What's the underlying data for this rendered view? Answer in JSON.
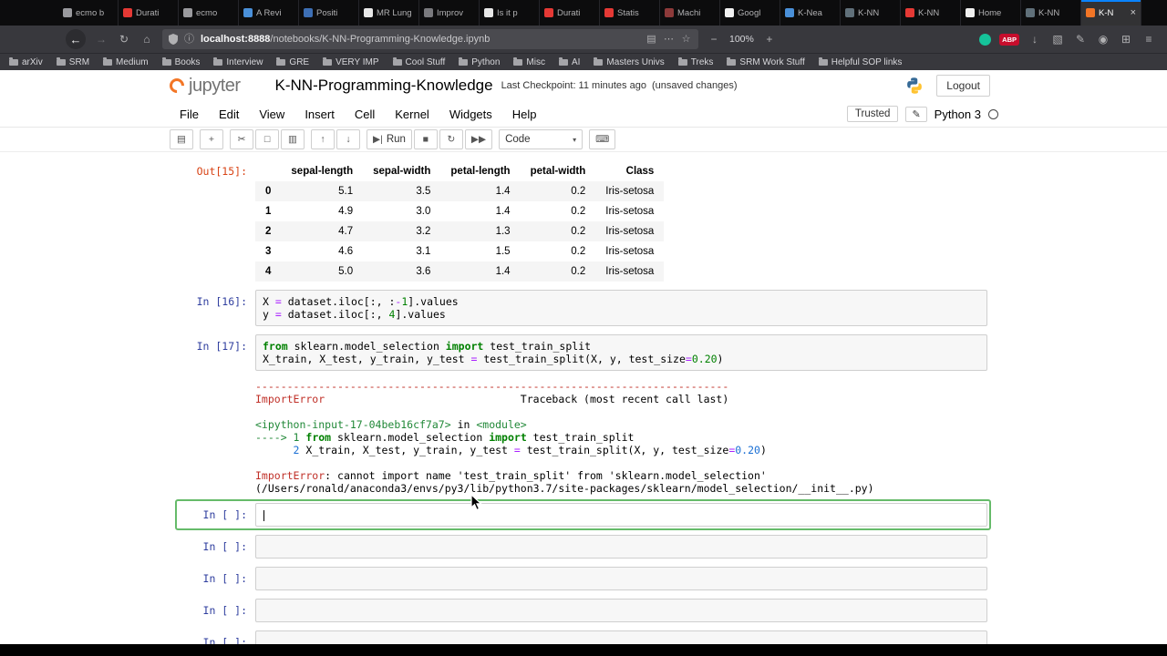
{
  "browser": {
    "tabs": [
      {
        "label": "ecmo b",
        "color": "#9a9a9e"
      },
      {
        "label": "Durati",
        "color": "#e53935"
      },
      {
        "label": "ecmo",
        "color": "#9a9a9e"
      },
      {
        "label": "A Revi",
        "color": "#4a90d9"
      },
      {
        "label": "Positi",
        "color": "#3d6fb5"
      },
      {
        "label": "MR Lung V",
        "color": "#e8e8e8"
      },
      {
        "label": "Improv",
        "color": "#7a7a7e"
      },
      {
        "label": "Is it p",
        "color": "#e8e8e8"
      },
      {
        "label": "Durati",
        "color": "#e53935"
      },
      {
        "label": "Statis",
        "color": "#e53935"
      },
      {
        "label": "Machi",
        "color": "#8d3a3a"
      },
      {
        "label": "Googl",
        "color": "#f1f1f1"
      },
      {
        "label": "K-Nea",
        "color": "#4a90d9"
      },
      {
        "label": "K-NN",
        "color": "#60707a"
      },
      {
        "label": "K-NN",
        "color": "#e53935"
      },
      {
        "label": "Home",
        "color": "#f0f0f0"
      },
      {
        "label": "K-NN",
        "color": "#60707a"
      },
      {
        "label": "K-N",
        "color": "#f37626",
        "active": true
      }
    ],
    "url_host": "localhost:8888",
    "url_path": "/notebooks/K-NN-Programming-Knowledge.ipynb",
    "zoom_level": "100%",
    "adblock_badge": "ABP",
    "bookmarks": [
      "arXiv",
      "SRM",
      "Medium",
      "Books",
      "Interview",
      "GRE",
      "VERY IMP",
      "Cool Stuff",
      "Python",
      "Misc",
      "AI",
      "Masters Univs",
      "Treks",
      "SRM Work Stuff",
      "Helpful SOP links"
    ],
    "icons": {
      "back": "←",
      "forward": "→",
      "reload": "↻",
      "home": "⌂",
      "info": "ⓘ",
      "reader": "▤",
      "more": "⋯",
      "bookmark": "☆",
      "zoom_out": "−",
      "zoom_in": "+",
      "download": "↓",
      "sidebar": "▧",
      "highlight": "✎",
      "account": "◉",
      "grid": "⊞",
      "menu": "≡"
    }
  },
  "jupyter": {
    "logo_text": "jupyter",
    "title": "K-NN-Programming-Knowledge",
    "checkpoint": "Last Checkpoint: 11 minutes ago",
    "unsaved": "(unsaved changes)",
    "logout_label": "Logout",
    "menus": [
      "File",
      "Edit",
      "View",
      "Insert",
      "Cell",
      "Kernel",
      "Widgets",
      "Help"
    ],
    "trusted_label": "Trusted",
    "pencil_icon": "✎",
    "kernel_name": "Python 3",
    "accent_green": "#66BB6A",
    "prompt_in_color": "#303F9F",
    "prompt_out_color": "#D84315",
    "toolbar": {
      "groups": [
        [
          {
            "name": "save-button",
            "glyph": "▤"
          }
        ],
        [
          {
            "name": "add-cell-button",
            "glyph": "+"
          }
        ],
        [
          {
            "name": "cut-button",
            "glyph": "✂"
          },
          {
            "name": "copy-button",
            "glyph": "□"
          },
          {
            "name": "paste-button",
            "glyph": "▥"
          }
        ],
        [
          {
            "name": "move-up-button",
            "glyph": "↑"
          },
          {
            "name": "move-down-button",
            "glyph": "↓"
          }
        ],
        [
          {
            "name": "run-button",
            "glyph": "▶|",
            "label": "Run"
          },
          {
            "name": "stop-button",
            "glyph": "■"
          },
          {
            "name": "restart-kernel-button",
            "glyph": "↻"
          },
          {
            "name": "restart-run-all-button",
            "glyph": "▶▶"
          }
        ],
        [
          {
            "name": "cell-type-select",
            "type": "select",
            "label": "Code",
            "glyph": "▾"
          }
        ],
        [
          {
            "name": "command-palette-button",
            "glyph": "⌨"
          }
        ]
      ]
    }
  },
  "notebook": {
    "cells": [
      {
        "type": "table",
        "prompt": "Out[15]:",
        "prompt_type": "out",
        "table": {
          "headers": [
            "",
            "sepal-length",
            "sepal-width",
            "petal-length",
            "petal-width",
            "Class"
          ],
          "rows": [
            [
              "0",
              "5.1",
              "3.5",
              "1.4",
              "0.2",
              "Iris-setosa"
            ],
            [
              "1",
              "4.9",
              "3.0",
              "1.4",
              "0.2",
              "Iris-setosa"
            ],
            [
              "2",
              "4.7",
              "3.2",
              "1.3",
              "0.2",
              "Iris-setosa"
            ],
            [
              "3",
              "4.6",
              "3.1",
              "1.5",
              "0.2",
              "Iris-setosa"
            ],
            [
              "4",
              "5.0",
              "3.6",
              "1.4",
              "0.2",
              "Iris-setosa"
            ]
          ]
        }
      },
      {
        "type": "code",
        "prompt": "In [16]:",
        "prompt_type": "in",
        "lines": [
          [
            [
              "plain",
              "X "
            ],
            [
              "op",
              "="
            ],
            [
              "plain",
              " dataset.iloc[:, :"
            ],
            [
              "op",
              "-"
            ],
            [
              "num",
              "1"
            ],
            [
              "plain",
              "].values"
            ]
          ],
          [
            [
              "plain",
              "y "
            ],
            [
              "op",
              "="
            ],
            [
              "plain",
              " dataset.iloc[:, "
            ],
            [
              "num",
              "4"
            ],
            [
              "plain",
              "].values"
            ]
          ]
        ]
      },
      {
        "type": "code",
        "prompt": "In [17]:",
        "prompt_type": "in",
        "lines": [
          [
            [
              "kw",
              "from"
            ],
            [
              "plain",
              " sklearn.model_selection "
            ],
            [
              "kw",
              "import"
            ],
            [
              "plain",
              " test_train_split"
            ]
          ],
          [
            [
              "plain",
              "X_train, X_test, y_train, y_test "
            ],
            [
              "op",
              "="
            ],
            [
              "plain",
              " test_train_split(X, y, test_size"
            ],
            [
              "op",
              "="
            ],
            [
              "num",
              "0.20"
            ],
            [
              "plain",
              ")"
            ]
          ]
        ],
        "error": [
          [
            [
              "red",
              "---------------------------------------------------------------------------"
            ]
          ],
          [
            [
              "red",
              "ImportError"
            ],
            [
              "plain",
              "                               Traceback (most recent call last)"
            ]
          ],
          [],
          [
            [
              "green",
              "<ipython-input-17-04beb16cf7a7>"
            ],
            [
              "plain",
              " in "
            ],
            [
              "green",
              "<module>"
            ]
          ],
          [
            [
              "green",
              "----> 1"
            ],
            [
              "plain",
              " "
            ],
            [
              "kw",
              "from"
            ],
            [
              "plain",
              " sklearn.model_selection "
            ],
            [
              "kw",
              "import"
            ],
            [
              "plain",
              " test_train_split"
            ]
          ],
          [
            [
              "plain",
              "      "
            ],
            [
              "blue",
              "2"
            ],
            [
              "plain",
              " X_train, X_test, y_train, y_test "
            ],
            [
              "op",
              "="
            ],
            [
              "plain",
              " test_train_split(X, y, test_size"
            ],
            [
              "op",
              "="
            ],
            [
              "blue",
              "0.20"
            ],
            [
              "plain",
              ")"
            ]
          ],
          [],
          [
            [
              "red",
              "ImportError"
            ],
            [
              "plain",
              ": cannot import name 'test_train_split' from 'sklearn.model_selection' (/Users/ronald/anaconda3/envs/py3/lib/python3.7/site-packages/sklearn/model_selection/__init__.py)"
            ]
          ]
        ]
      },
      {
        "type": "empty",
        "prompt": "In [ ]:",
        "prompt_type": "in",
        "selected": true
      },
      {
        "type": "empty",
        "prompt": "In [ ]:",
        "prompt_type": "in"
      },
      {
        "type": "empty",
        "prompt": "In [ ]:",
        "prompt_type": "in"
      },
      {
        "type": "empty",
        "prompt": "In [ ]:",
        "prompt_type": "in"
      },
      {
        "type": "empty",
        "prompt": "In [ ]:",
        "prompt_type": "in"
      }
    ]
  }
}
